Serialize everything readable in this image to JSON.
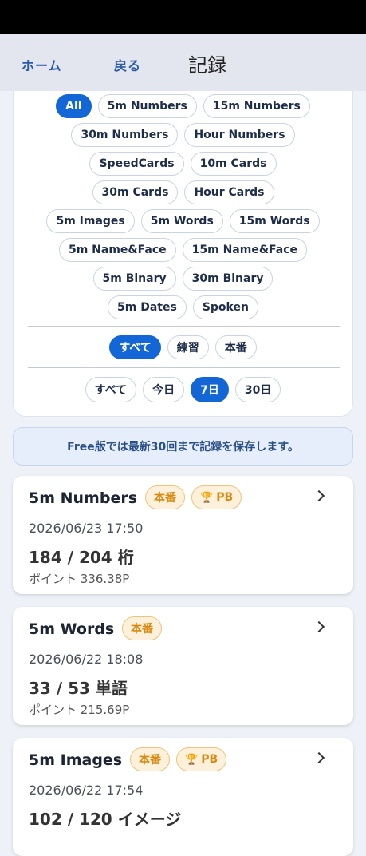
{
  "header": {
    "home_label": "ホーム",
    "back_label": "戻る",
    "title": "記録"
  },
  "disciplines": {
    "rows": [
      [
        {
          "label": "All",
          "active": true
        },
        {
          "label": "5m Numbers"
        },
        {
          "label": "15m Numbers"
        }
      ],
      [
        {
          "label": "30m Numbers"
        },
        {
          "label": "Hour Numbers"
        }
      ],
      [
        {
          "label": "SpeedCards"
        },
        {
          "label": "10m Cards"
        }
      ],
      [
        {
          "label": "30m Cards"
        },
        {
          "label": "Hour Cards"
        }
      ],
      [
        {
          "label": "5m Images"
        },
        {
          "label": "5m Words"
        },
        {
          "label": "15m Words"
        }
      ],
      [
        {
          "label": "5m Name&Face"
        },
        {
          "label": "15m Name&Face"
        }
      ],
      [
        {
          "label": "5m Binary"
        },
        {
          "label": "30m Binary"
        }
      ],
      [
        {
          "label": "5m Dates"
        },
        {
          "label": "Spoken"
        }
      ]
    ]
  },
  "mode_filter": [
    {
      "label": "すべて",
      "active": true
    },
    {
      "label": "練習"
    },
    {
      "label": "本番"
    }
  ],
  "period_filter": [
    {
      "label": "すべて"
    },
    {
      "label": "今日"
    },
    {
      "label": "7日",
      "active": true
    },
    {
      "label": "30日"
    }
  ],
  "notice": "Free版では最新30回まで記録を保存します。",
  "records": [
    {
      "name": "5m Numbers",
      "badges": [
        "本番",
        "PB"
      ],
      "date": "2026/06/23 17:50",
      "score": "184 / 204 桁",
      "points": "ポイント 336.38P"
    },
    {
      "name": "5m Words",
      "badges": [
        "本番"
      ],
      "date": "2026/06/22 18:08",
      "score": "33 / 53 単語",
      "points": "ポイント 215.69P"
    },
    {
      "name": "5m Images",
      "badges": [
        "本番",
        "PB"
      ],
      "date": "2026/06/22 17:54",
      "score": "102 / 120 イメージ",
      "points": ""
    }
  ],
  "colors": {
    "accent": "#1366d6",
    "badge": "#d98a12"
  }
}
